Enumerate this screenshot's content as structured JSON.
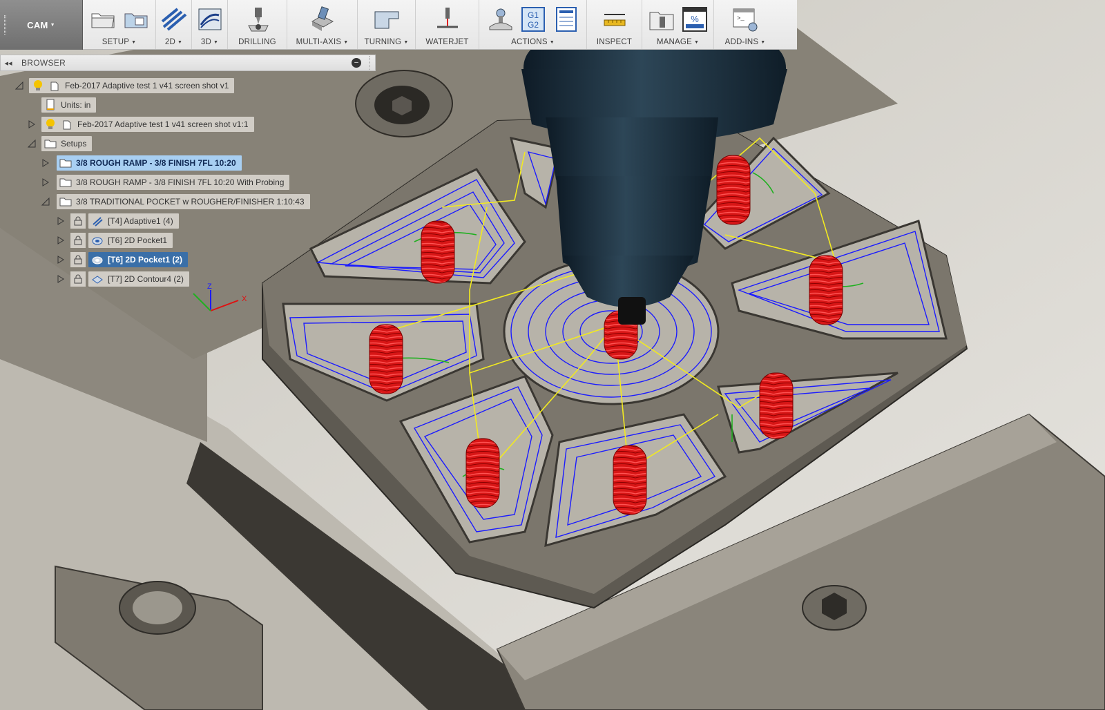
{
  "toolbar": {
    "workspace": "CAM",
    "groups": [
      {
        "label": "SETUP",
        "dropdown": true
      },
      {
        "label": "2D",
        "dropdown": true
      },
      {
        "label": "3D",
        "dropdown": true
      },
      {
        "label": "DRILLING",
        "dropdown": false
      },
      {
        "label": "MULTI-AXIS",
        "dropdown": true
      },
      {
        "label": "TURNING",
        "dropdown": true
      },
      {
        "label": "WATERJET",
        "dropdown": false
      },
      {
        "label": "ACTIONS",
        "dropdown": true
      },
      {
        "label": "INSPECT",
        "dropdown": false
      },
      {
        "label": "MANAGE",
        "dropdown": true
      },
      {
        "label": "ADD-INS",
        "dropdown": true
      }
    ],
    "actions_icon_text": [
      "G1",
      "G2"
    ],
    "manage_icon_text": "%"
  },
  "browser": {
    "title": "BROWSER",
    "tree": {
      "root": "Feb-2017 Adaptive test 1 v41 screen shot v1",
      "units": "Units: in",
      "component": "Feb-2017 Adaptive test 1 v41 screen shot v1:1",
      "setups": "Setups",
      "setup_items": [
        "3/8 ROUGH RAMP - 3/8 FINISH 7FL 10:20",
        "3/8 ROUGH RAMP - 3/8 FINISH 7FL 10:20 With Probing",
        "3/8 TRADITIONAL POCKET w ROUGHER/FINISHER 1:10:43"
      ],
      "operations": [
        "[T4] Adaptive1 (4)",
        "[T6] 2D Pocket1",
        "[T6] 2D Pocket1 (2)",
        "[T7] 2D Contour4 (2)"
      ]
    }
  },
  "viewport": {
    "axes": [
      "Z",
      "X"
    ]
  },
  "colors": {
    "part": "#6e6a61",
    "part_dark": "#4a4740",
    "floor": "#b9b6ad",
    "toolpath_blue": "#1b1bff",
    "toolpath_red": "#e01010",
    "toolpath_green": "#20b020",
    "rapid_yellow": "#f2ea20",
    "spindle": "#1f3140",
    "selection": "#3a6fa8",
    "highlight": "#a8cff2"
  }
}
